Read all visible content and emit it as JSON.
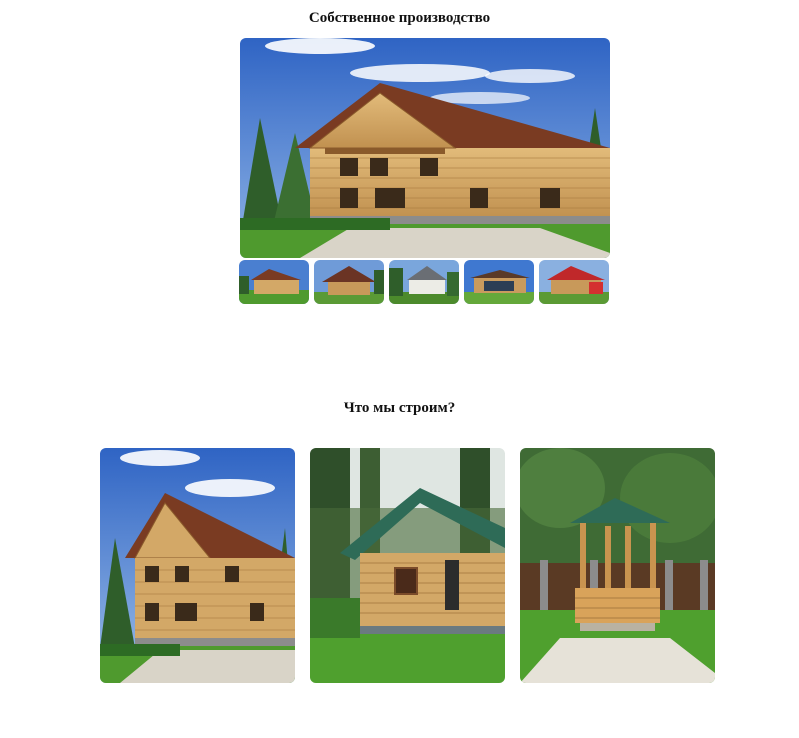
{
  "production": {
    "title": "Собственное производство",
    "main_image": "two-storey-log-house-with-balcony",
    "thumbnails": [
      {
        "image": "log-house-front"
      },
      {
        "image": "log-house-brown-roof"
      },
      {
        "image": "house-white-grey-roof"
      },
      {
        "image": "house-panoramic-windows"
      },
      {
        "image": "house-red-roof"
      }
    ]
  },
  "build": {
    "title": "Что мы строим?",
    "cards": [
      {
        "image": "log-house-two-storey"
      },
      {
        "image": "log-bathhouse-green-roof"
      },
      {
        "image": "log-gazebo-green-roof"
      }
    ]
  },
  "colors": {
    "sky": "#3f74c9",
    "log": "#d3a867",
    "roof_brown": "#7a3b22",
    "roof_green": "#2e6b57",
    "grass": "#4f9a2e"
  }
}
